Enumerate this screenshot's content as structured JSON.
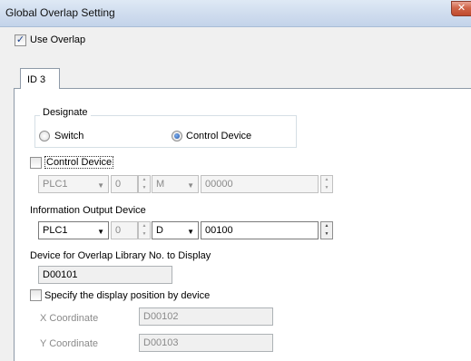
{
  "window": {
    "title": "Global Overlap Setting",
    "close_glyph": "✕"
  },
  "use_overlap": {
    "label": "Use Overlap",
    "checked": true
  },
  "tab": {
    "label": "ID 3"
  },
  "designate": {
    "title": "Designate",
    "options": [
      {
        "label": "Switch",
        "selected": false
      },
      {
        "label": "Control Device",
        "selected": true
      }
    ]
  },
  "control_device": {
    "label": "Control Device",
    "checked": false,
    "plc": "PLC1",
    "station": "0",
    "device_type": "M",
    "address": "00000"
  },
  "info_output": {
    "label": "Information Output Device",
    "plc": "PLC1",
    "station": "0",
    "device_type": "D",
    "address": "00100"
  },
  "library_display": {
    "label": "Device for Overlap Library No. to Display",
    "value": "D00101"
  },
  "display_position": {
    "label": "Specify the display position by device",
    "checked": false,
    "x_label": "X Coordinate",
    "x_value": "D00102",
    "y_label": "Y Coordinate",
    "y_value": "D00103"
  },
  "icons": {
    "close": "close-icon",
    "dropdown": "chevron-down-icon",
    "spinner": "spin-arrows-icon",
    "check": "checkmark-icon"
  }
}
